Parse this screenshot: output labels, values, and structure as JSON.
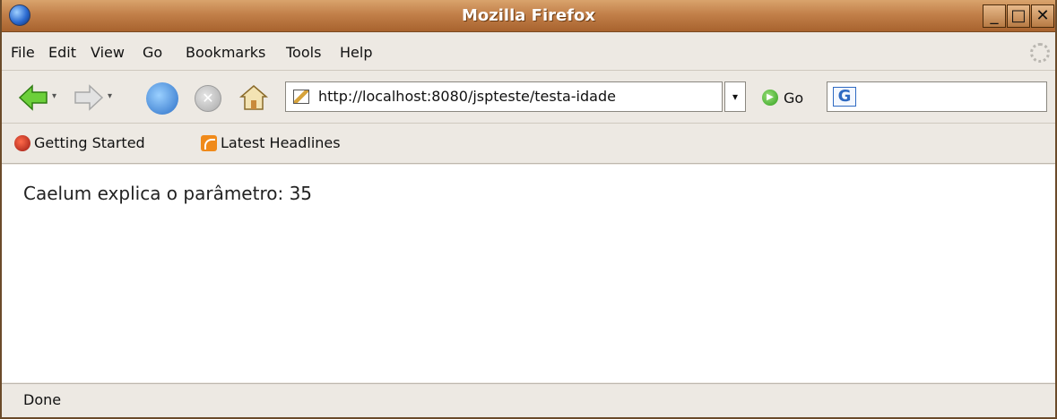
{
  "window": {
    "title": "Mozilla Firefox",
    "controls": {
      "minimize": "_",
      "maximize": "□",
      "close": "✕"
    }
  },
  "menu": {
    "items": [
      {
        "label": "File"
      },
      {
        "label": "Edit"
      },
      {
        "label": "View"
      },
      {
        "label": "Go"
      },
      {
        "label": "Bookmarks"
      },
      {
        "label": "Tools"
      },
      {
        "label": "Help"
      }
    ]
  },
  "navbar": {
    "url": "http://localhost:8080/jspteste/testa-idade",
    "go_label": "Go",
    "search_placeholder": ""
  },
  "bookmarks": [
    {
      "label": "Getting Started",
      "icon": "firefox-icon"
    },
    {
      "label": "Latest Headlines",
      "icon": "rss-icon"
    }
  ],
  "content": {
    "text": "Caelum explica o parâmetro: 35"
  },
  "status": {
    "text": "Done"
  },
  "colors": {
    "titlebar": "#c2804a",
    "chrome": "#ede9e3",
    "content_bg": "#ffffff"
  }
}
